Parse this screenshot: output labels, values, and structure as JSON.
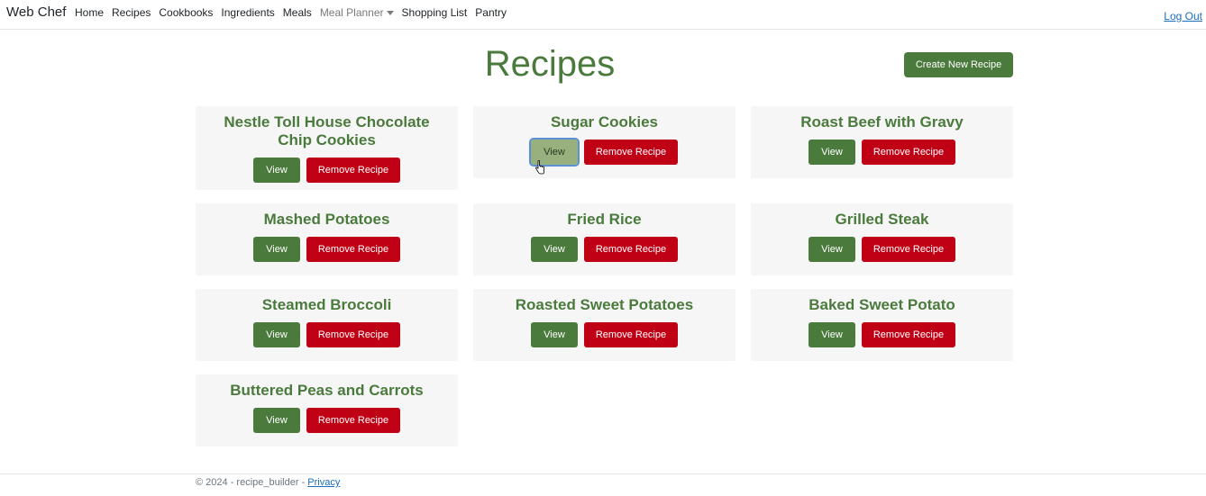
{
  "navbar": {
    "brand": "Web Chef",
    "links": [
      "Home",
      "Recipes",
      "Cookbooks",
      "Ingredients",
      "Meals"
    ],
    "meal_planner": "Meal Planner",
    "links_after": [
      "Shopping List",
      "Pantry"
    ],
    "logout": "Log Out"
  },
  "header": {
    "title": "Recipes",
    "create_button": "Create New Recipe"
  },
  "card_buttons": {
    "view": "View",
    "remove": "Remove Recipe"
  },
  "recipes": [
    "Nestle Toll House Chocolate Chip Cookies",
    "Sugar Cookies",
    "Roast Beef with Gravy",
    "Mashed Potatoes",
    "Fried Rice",
    "Grilled Steak",
    "Steamed Broccoli",
    "Roasted Sweet Potatoes",
    "Baked Sweet Potato",
    "Buttered Peas and Carrots"
  ],
  "footer": {
    "text": "© 2024 - recipe_builder - ",
    "privacy": "Privacy"
  },
  "colors": {
    "brand_green": "#4a7a3c",
    "danger_red": "#c00015",
    "hover_green": "#98b07e",
    "link_blue": "#1b6ec2"
  }
}
